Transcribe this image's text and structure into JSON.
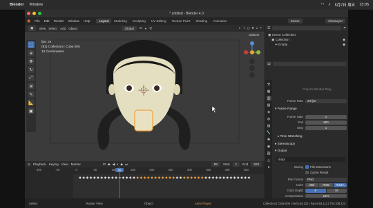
{
  "macbar": {
    "app": "Blender",
    "menu": [
      "Window"
    ],
    "date": "5月7日 周五",
    "time": "13:05"
  },
  "window": {
    "title": "* untitled - Blender 4.0"
  },
  "topbar": {
    "menu": [
      "File",
      "Edit",
      "Render",
      "Window",
      "Help"
    ],
    "workspaces": [
      "Layout",
      "Modeling",
      "Sculpting",
      "UV Editing",
      "Texture Paint",
      "Shading",
      "Animation"
    ],
    "active_workspace": "Layout",
    "scene": "Scene",
    "view_layer": "ViewLayer"
  },
  "viewport": {
    "header": [
      "View",
      "Select",
      "Add",
      "Object"
    ],
    "mode": "Object Mode",
    "orientation": "Global",
    "options": "Options",
    "info": [
      "fps: 24",
      "(91) Collection | Cube.005",
      "10 Centimeters"
    ]
  },
  "timeline": {
    "header": [
      "Playback",
      "Keying",
      "View",
      "Marker"
    ],
    "current_frame": "99",
    "start_label": "Start",
    "start": "1",
    "end_label": "End",
    "end": "500",
    "ruler": [
      "-100",
      "-50",
      "0",
      "50",
      "100",
      "150",
      "200",
      "250",
      "300",
      "350",
      "400",
      "450"
    ],
    "playhead": "99"
  },
  "statusbar": {
    "select": "Select",
    "rotate": "Rotate View",
    "object": "Object",
    "player": "Anim Player",
    "stats": "Collection | Cube.005 | Verts:54,122 | Faces:54,112 | Tris:108,224"
  },
  "outliner": {
    "items": [
      "Scene Collection",
      "Collection",
      "Empty"
    ]
  },
  "properties": {
    "frame_rate_label": "Frame Rate",
    "frame_rate": "24 fps",
    "frame_range_title": "Frame Range",
    "frame_start_label": "Frame Start",
    "frame_start": "1",
    "end_label": "End",
    "end": "500",
    "step_label": "Step",
    "step": "1",
    "time_stretching": "Time Stretching",
    "stereoscopy": "Stereoscopy",
    "output_title": "Output",
    "output_path": "/tmp/",
    "saving_label": "Saving",
    "file_extensions": "File Extensions",
    "cache_result": "Cache Result",
    "file_format_label": "File Format",
    "file_format": "PNG",
    "color_label": "Color",
    "color_options": [
      "BW",
      "RGB",
      "RGBA"
    ],
    "color_depth_label": "Color Depth",
    "color_depth": [
      "8",
      "16"
    ],
    "compression_label": "Compression",
    "compression": "15%",
    "crop_text": "Crop to Render Reg..."
  }
}
